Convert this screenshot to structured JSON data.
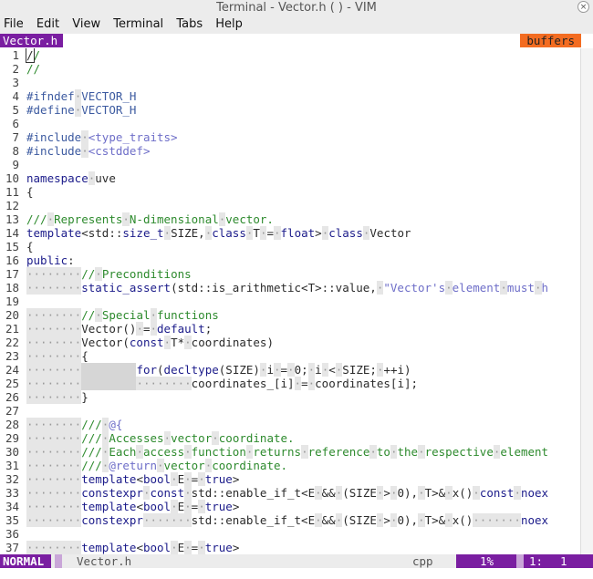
{
  "window": {
    "title": "Terminal - Vector.h (                    ) - VIM",
    "close_symbol": "×"
  },
  "menu": [
    "File",
    "Edit",
    "View",
    "Terminal",
    "Tabs",
    "Help"
  ],
  "tabline": {
    "active_tab": "Vector.h",
    "buffers_label": "buffers"
  },
  "status": {
    "mode": "NORMAL",
    "file": "Vector.h",
    "filetype": "cpp",
    "percent": "1%",
    "line": "1:",
    "col": "1"
  },
  "line_numbers": [
    "1",
    "2",
    "3",
    "4",
    "5",
    "6",
    "7",
    "8",
    "9",
    "10",
    "11",
    "12",
    "13",
    "14",
    "15",
    "16",
    "17",
    "18",
    "19",
    "20",
    "21",
    "22",
    "23",
    "24",
    "25",
    "26",
    "27",
    "28",
    "29",
    "30",
    "31",
    "32",
    "33",
    "34",
    "35",
    "36",
    "37"
  ]
}
